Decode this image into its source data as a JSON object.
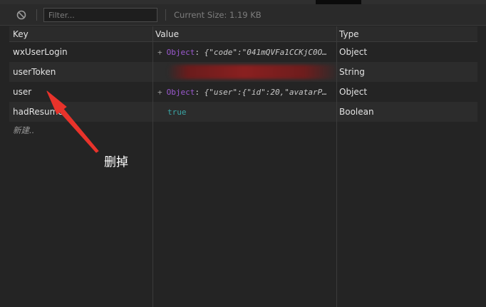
{
  "toolbar": {
    "clear_icon": "clear-icon",
    "filter_placeholder": "Filter...",
    "current_size": "Current Size: 1.19 KB"
  },
  "table": {
    "columns": [
      "Key",
      "Value",
      "Type"
    ],
    "rows": [
      {
        "key": "wxUserLogin",
        "value_kind": "object",
        "value_name": "Object",
        "value_colon": ":",
        "value_preview": "{\"code\":\"041mQVFa1CCKjC0O…",
        "type": "Object"
      },
      {
        "key": "userToken",
        "value_kind": "redacted",
        "type": "String"
      },
      {
        "key": "user",
        "value_kind": "object",
        "value_name": "Object",
        "value_colon": ":",
        "value_preview": "{\"user\":{\"id\":20,\"avatarP…",
        "type": "Object"
      },
      {
        "key": "hadResume",
        "value_kind": "boolean",
        "value_text": "true",
        "type": "Boolean"
      }
    ],
    "new_row_placeholder": "新建.."
  },
  "annotation": {
    "text": "删掉",
    "arrow_color": "#e8332b"
  }
}
